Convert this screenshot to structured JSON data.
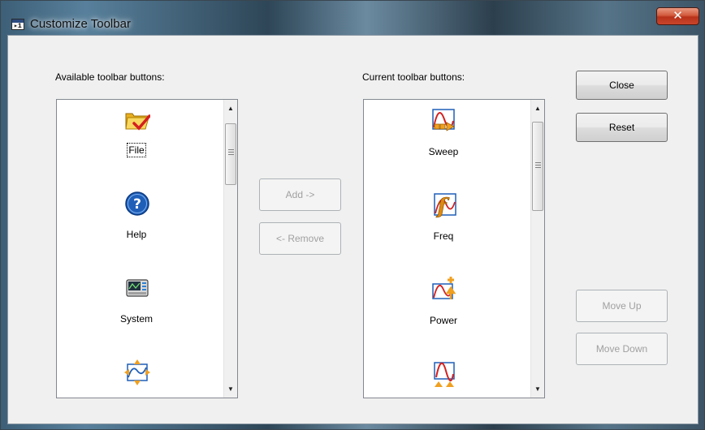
{
  "window": {
    "title": "Customize Toolbar",
    "close_glyph": "✕",
    "app_icon": "toolbar-app-icon"
  },
  "available": {
    "label": "Available toolbar buttons:",
    "items": [
      {
        "label": "File",
        "icon": "folder-check-icon"
      },
      {
        "label": "Help",
        "icon": "help-icon"
      },
      {
        "label": "System",
        "icon": "system-icon"
      },
      {
        "label": "",
        "icon": "marker-icon"
      }
    ]
  },
  "current": {
    "label": "Current toolbar buttons:",
    "items": [
      {
        "label": "Sweep",
        "icon": "sweep-icon"
      },
      {
        "label": "Freq",
        "icon": "freq-icon"
      },
      {
        "label": "Power",
        "icon": "power-icon"
      },
      {
        "label": "",
        "icon": "trigger-icon"
      }
    ]
  },
  "buttons": {
    "add": "Add ->",
    "remove": "<- Remove",
    "close": "Close",
    "reset": "Reset",
    "move_up": "Move Up",
    "move_down": "Move Down"
  },
  "colors": {
    "icon_red": "#d42020",
    "icon_blue": "#1f5fb8",
    "folder_yellow": "#f4c430",
    "accent_orange": "#f0a020"
  }
}
